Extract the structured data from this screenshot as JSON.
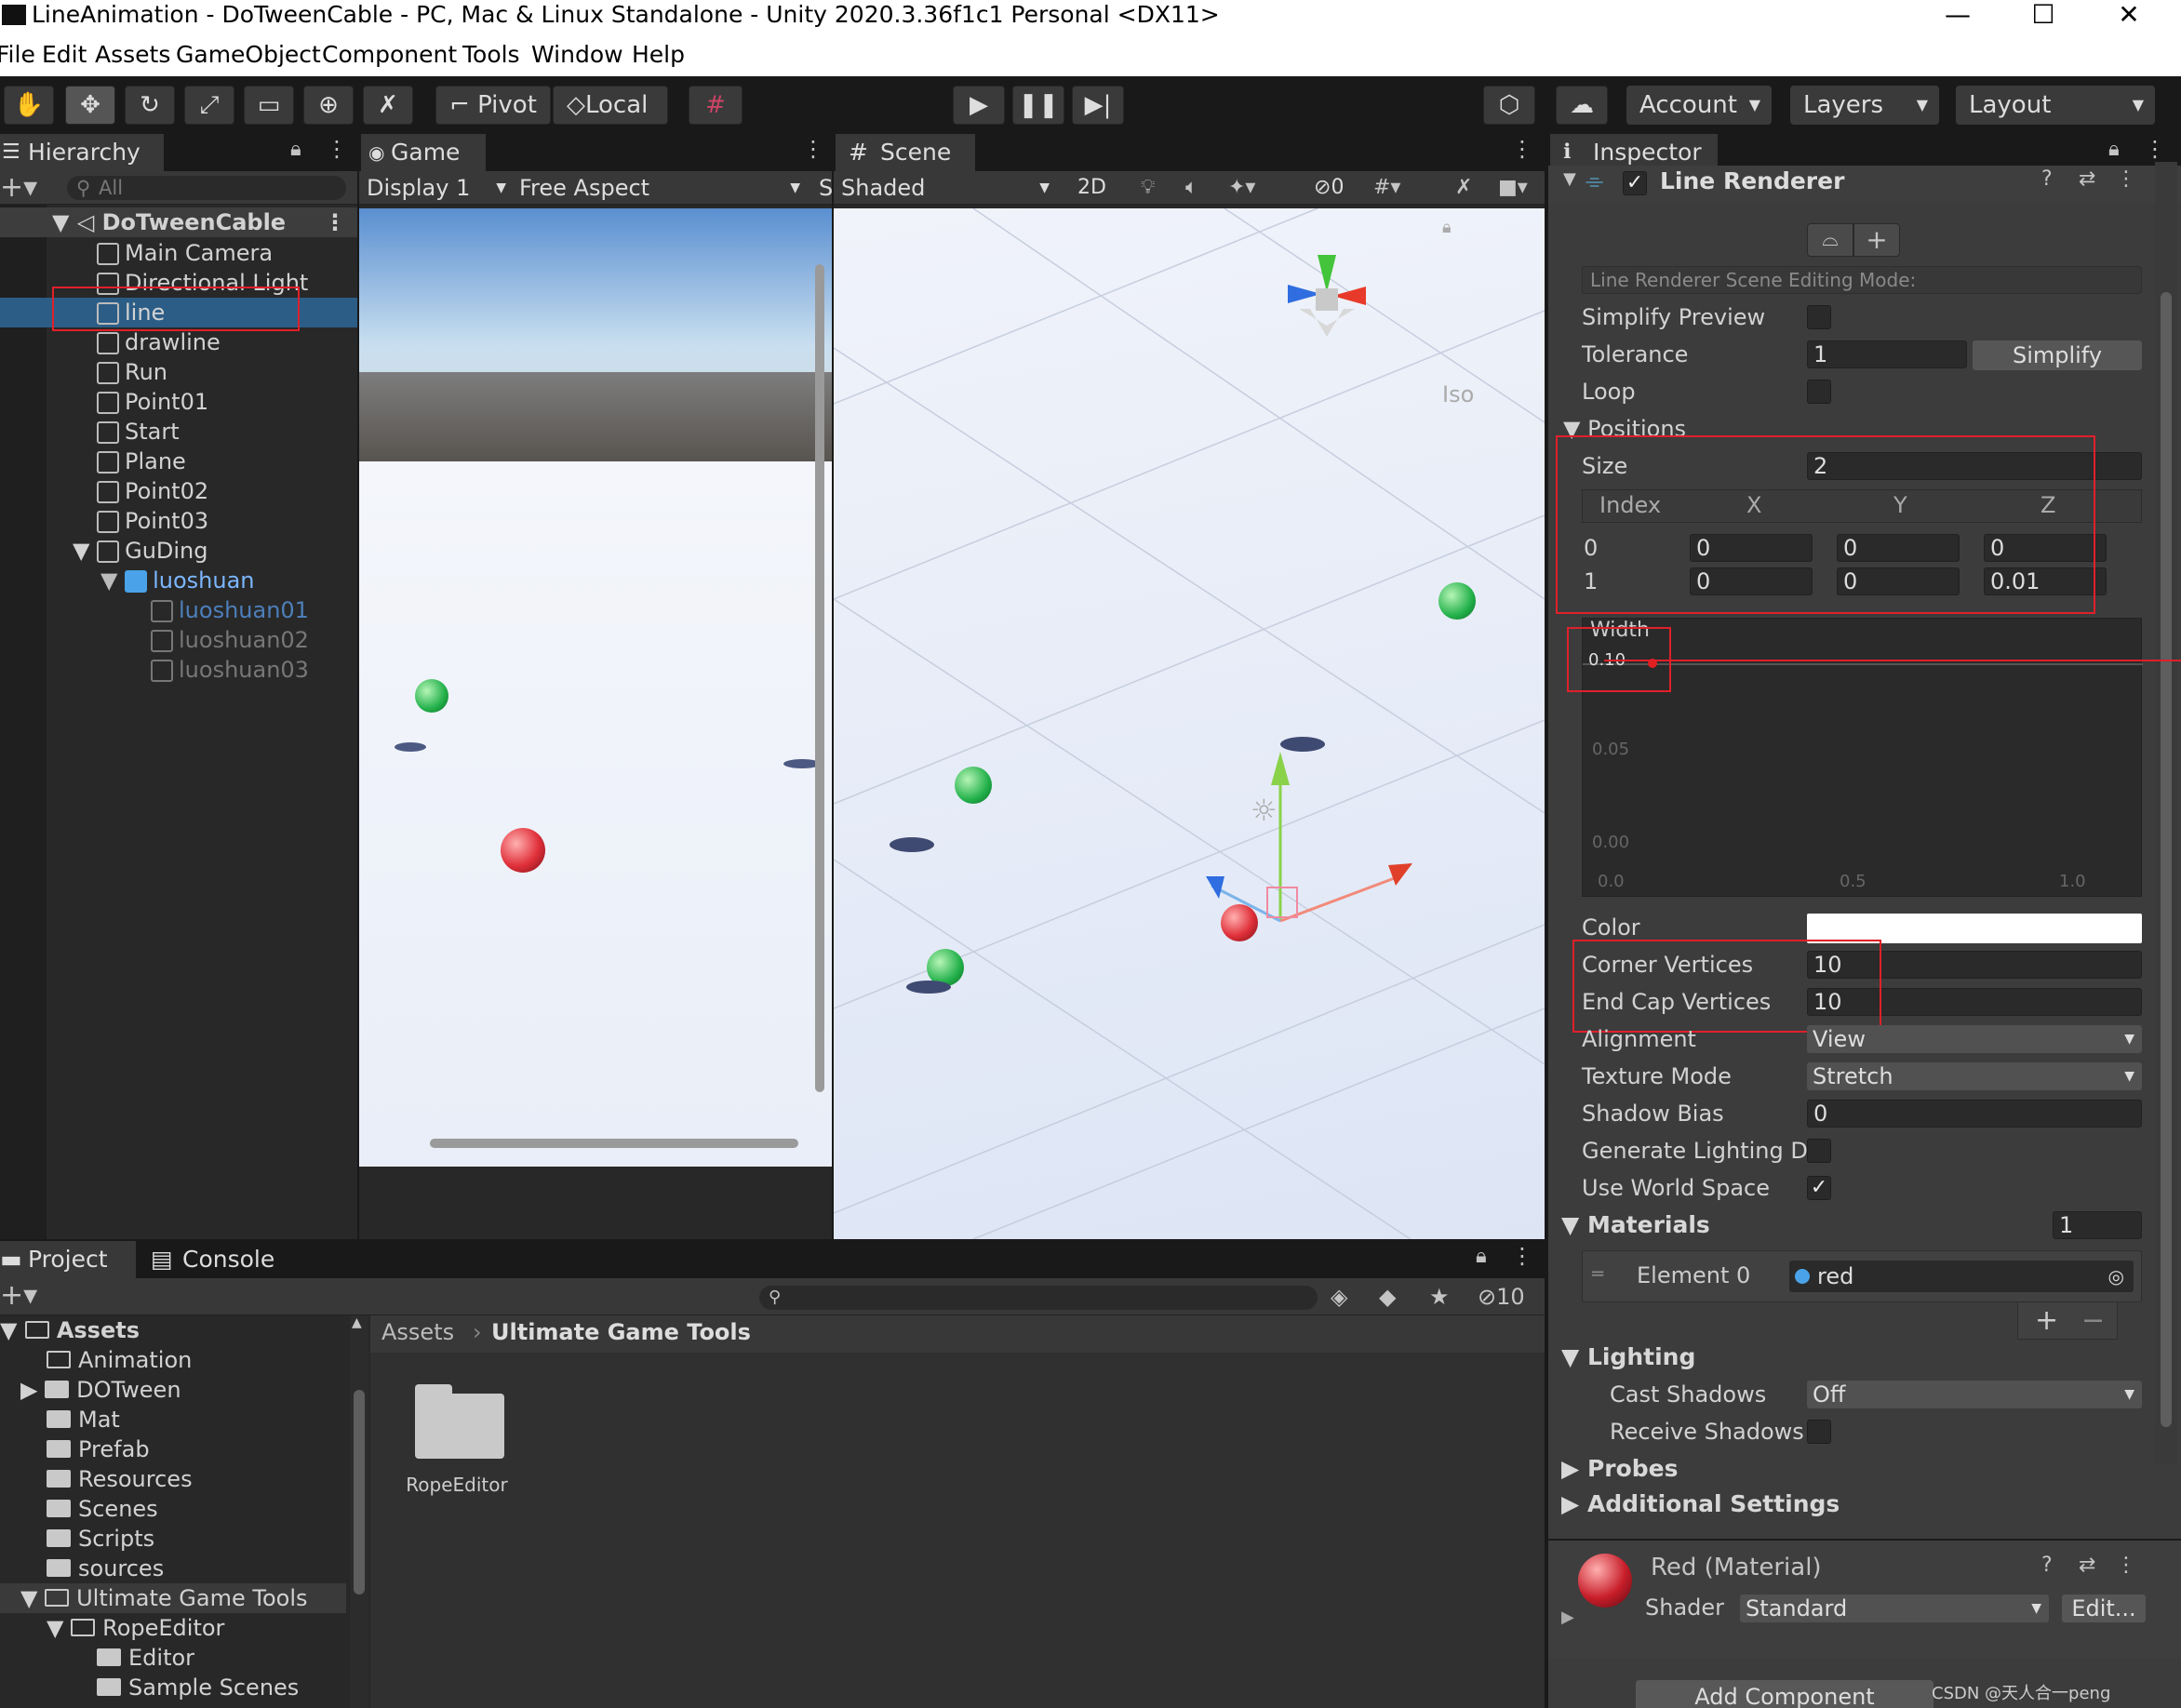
{
  "window": {
    "title": "LineAnimation - DoTweenCable - PC, Mac & Linux Standalone - Unity 2020.3.36f1c1 Personal <DX11>"
  },
  "menu": [
    "File",
    "Edit",
    "Assets",
    "GameObject",
    "Component",
    "Tools",
    "Window",
    "Help"
  ],
  "toolbar": {
    "pivot": "Pivot",
    "local": "Local",
    "account": "Account",
    "layers": "Layers",
    "layout": "Layout"
  },
  "hierarchy": {
    "tab": "Hierarchy",
    "search_placeholder": "All",
    "scene": "DoTweenCable",
    "items": [
      "Main Camera",
      "Directional Light",
      "line",
      "drawline",
      "Run",
      "Point01",
      "Start",
      "Plane",
      "Point02",
      "Point03",
      "GuDing",
      "luoshuan",
      "luoshuan01",
      "luoshuan02",
      "luoshuan03"
    ]
  },
  "game": {
    "tab": "Game",
    "display": "Display 1",
    "aspect": "Free Aspect",
    "s": "S"
  },
  "scene": {
    "tab": "Scene",
    "shading": "Shaded",
    "mode2d": "2D",
    "hidden_count": "0",
    "gizmo_label": "Iso"
  },
  "inspector": {
    "tab": "Inspector",
    "component": "Line Renderer",
    "editing_mode": "Line Renderer Scene Editing Mode:",
    "simplify_preview": "Simplify Preview",
    "tolerance_label": "Tolerance",
    "tolerance": "1",
    "simplify_btn": "Simplify",
    "loop": "Loop",
    "positions": "Positions",
    "size_label": "Size",
    "size": "2",
    "cols": [
      "Index",
      "X",
      "Y",
      "Z"
    ],
    "rows": [
      [
        "0",
        "0",
        "0",
        "0"
      ],
      [
        "1",
        "0",
        "0",
        "0.01"
      ]
    ],
    "width_label": "Width",
    "width_value": "0.10",
    "y_ticks": [
      "0.05",
      "0.00"
    ],
    "x_ticks": [
      "0.0",
      "0.5",
      "1.0"
    ],
    "color_label": "Color",
    "corner_label": "Corner Vertices",
    "corner": "10",
    "endcap_label": "End Cap Vertices",
    "endcap": "10",
    "alignment_label": "Alignment",
    "alignment": "View",
    "texture_label": "Texture Mode",
    "texture": "Stretch",
    "shadowbias_label": "Shadow Bias",
    "shadowbias": "0",
    "genlight_label": "Generate Lighting Da",
    "worldspace_label": "Use World Space",
    "materials_label": "Materials",
    "materials_count": "1",
    "element0_label": "Element 0",
    "element0": "red",
    "lighting_label": "Lighting",
    "castshadows_label": "Cast Shadows",
    "castshadows": "Off",
    "receive_label": "Receive Shadows",
    "probes_label": "Probes",
    "additional_label": "Additional Settings",
    "material_name": "Red (Material)",
    "shader_label": "Shader",
    "shader": "Standard",
    "edit_btn": "Edit...",
    "add_component": "Add Component"
  },
  "project": {
    "tab": "Project",
    "console_tab": "Console",
    "hidden_count": "10",
    "breadcrumb_root": "Assets",
    "breadcrumb_current": "Ultimate Game Tools",
    "tree": [
      "Assets",
      "Animation",
      "DOTween",
      "Mat",
      "Prefab",
      "Resources",
      "Scenes",
      "Scripts",
      "sources",
      "Ultimate Game Tools",
      "RopeEditor",
      "Editor",
      "Sample Scenes"
    ],
    "folder_item": "RopeEditor"
  },
  "watermark": "CSDN @天人合一peng",
  "colors": {
    "selection": "#2c5d87",
    "red_annotation": "#e0202a",
    "accent_blue": "#7cb6ff"
  }
}
